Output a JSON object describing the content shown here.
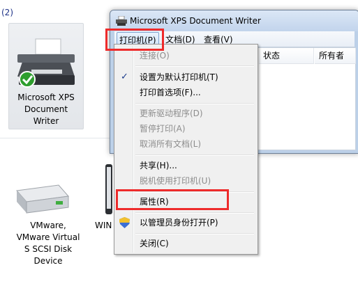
{
  "explorer": {
    "group_count": "(2)",
    "printer": {
      "name_lines": [
        "Microsoft XPS",
        "Document",
        "Writer"
      ]
    },
    "devices": [
      {
        "name_lines": [
          "VMware,",
          "VMware Virtual",
          "S SCSI Disk",
          "Device"
        ]
      },
      {
        "name_lines": [
          "WIN"
        ]
      }
    ]
  },
  "window": {
    "title": "Microsoft XPS Document Writer",
    "menus": [
      "打印机(P)",
      "文档(D)",
      "查看(V)"
    ],
    "columns": [
      "状态",
      "所有者"
    ]
  },
  "context_menu": {
    "items": [
      {
        "label": "连接(O)"
      },
      {
        "label": "设置为默认打印机(T)"
      },
      {
        "label": "打印首选项(F)..."
      },
      {
        "label": "更新驱动程序(D)"
      },
      {
        "label": "暂停打印(A)"
      },
      {
        "label": "取消所有文档(L)"
      },
      {
        "label": "共享(H)..."
      },
      {
        "label": "脱机使用打印机(U)"
      },
      {
        "label": "属性(R)"
      },
      {
        "label": "以管理员身份打开(P)"
      },
      {
        "label": "关闭(C)"
      }
    ],
    "check_glyph": "✓"
  },
  "colors": {
    "highlight_border": "#ee2b2b",
    "menu_bg": "#f0f0f0",
    "title_bar": "#c2d4ec"
  }
}
